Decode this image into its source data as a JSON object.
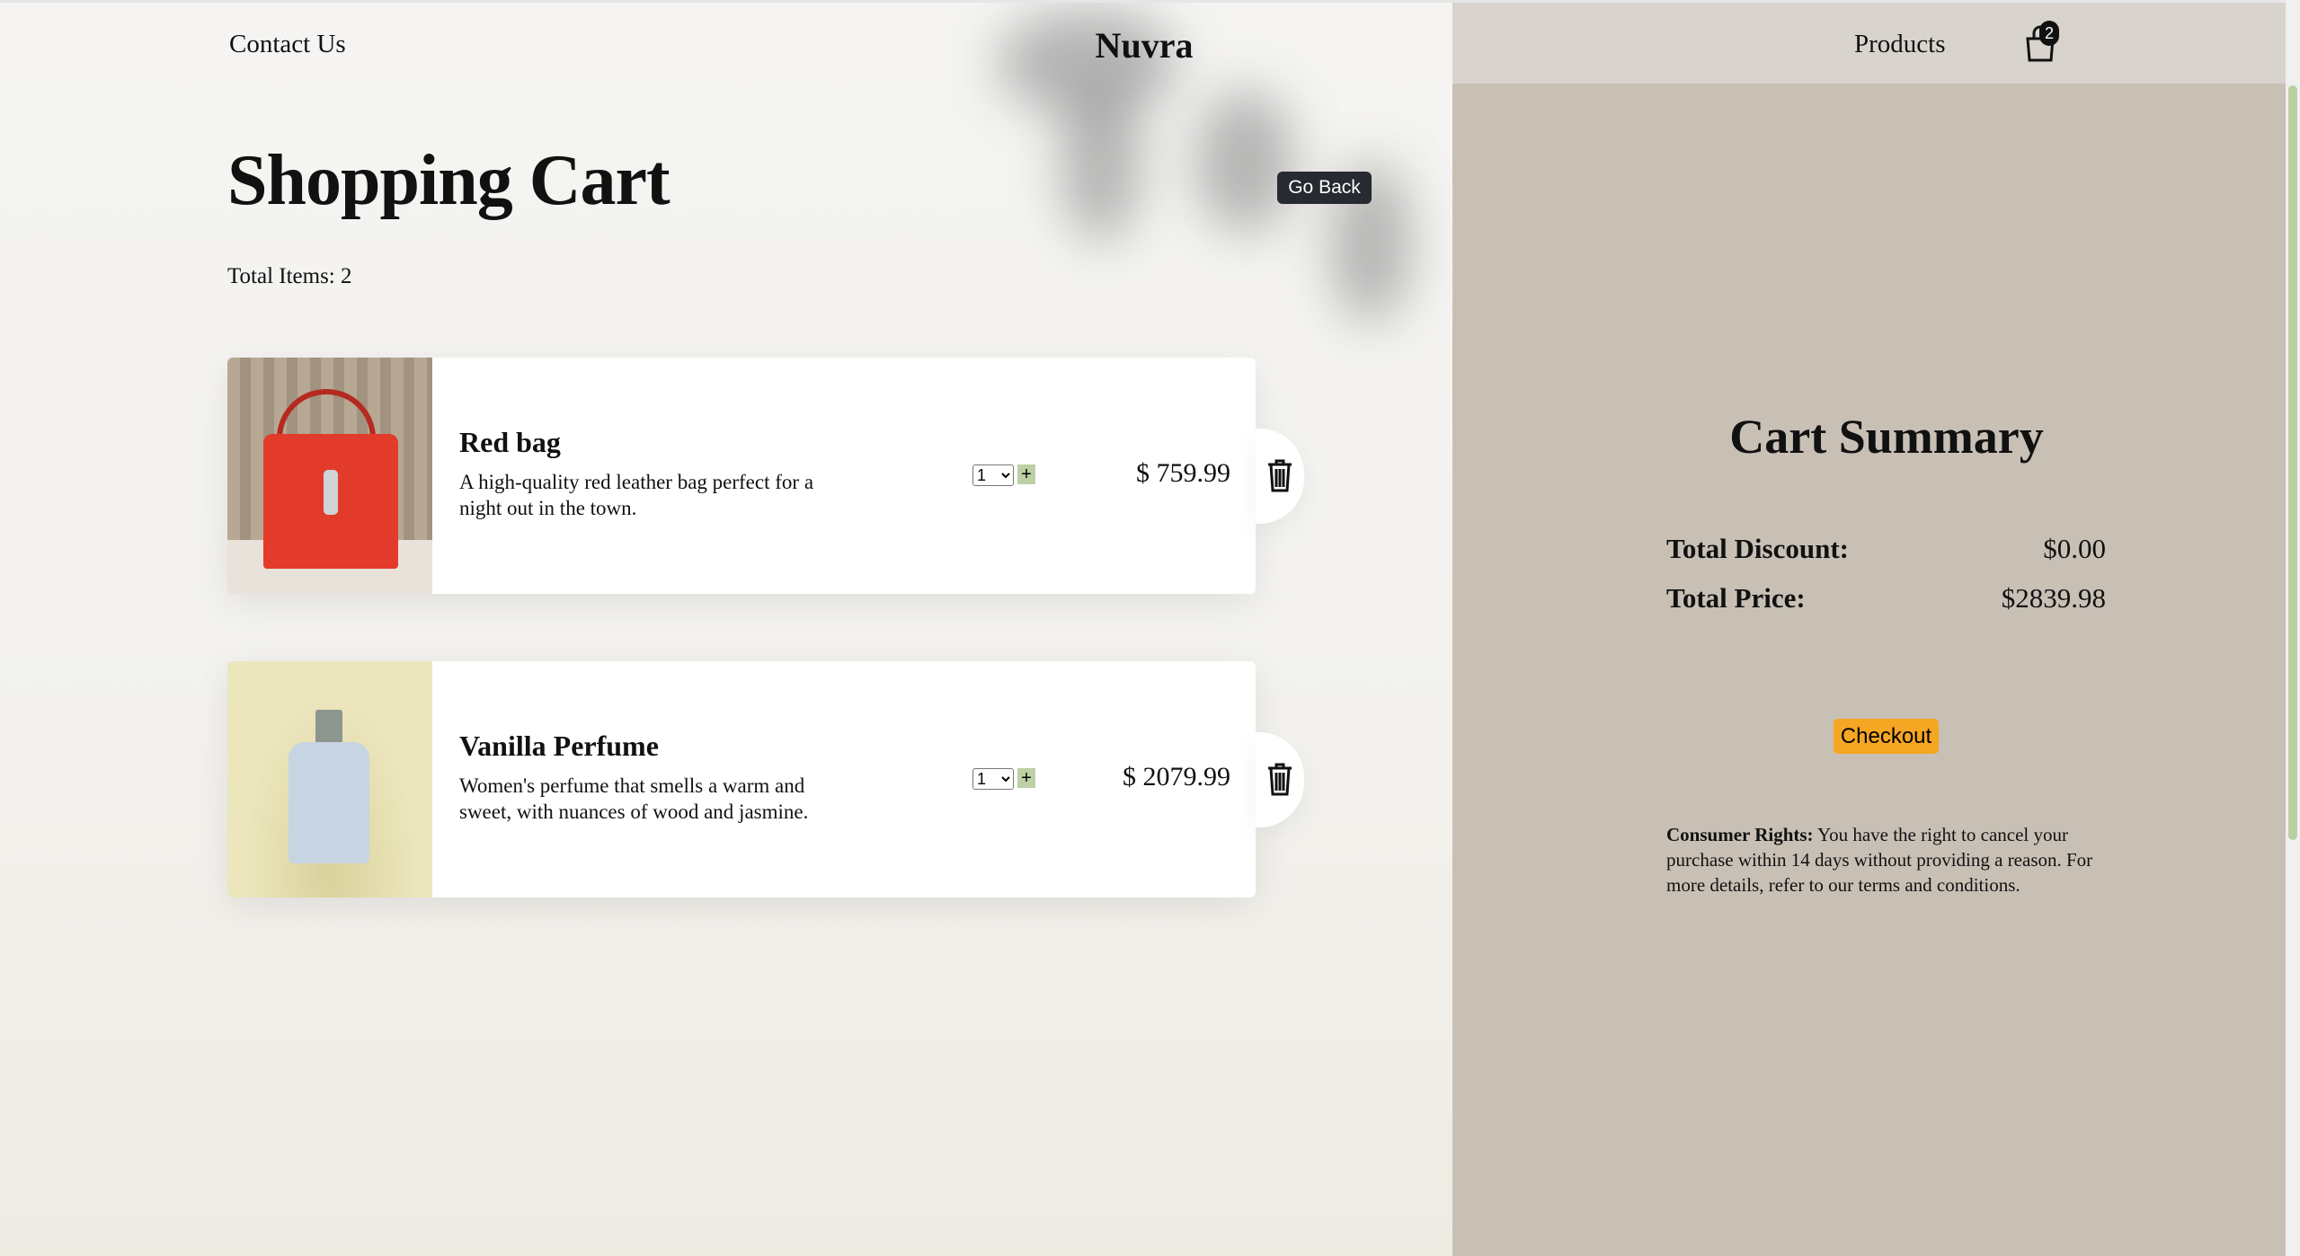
{
  "header": {
    "contact": "Contact Us",
    "logo": "Nuvra",
    "products": "Products",
    "cart_count": "2",
    "cart_icon": "shopping-bag-icon"
  },
  "main": {
    "title": "Shopping Cart",
    "go_back": "Go Back",
    "total_items": "Total Items: 2",
    "items": [
      {
        "name": "Red bag",
        "description": "A high-quality red leather bag perfect for a night out in the town.",
        "quantity": "1",
        "price": "$ 759.99"
      },
      {
        "name": "Vanilla Perfume",
        "description": "Women's perfume that smells a warm and sweet, with nuances of wood and jasmine.",
        "quantity": "1",
        "price": "$ 2079.99"
      }
    ]
  },
  "summary": {
    "title": "Cart Summary",
    "discount_label": "Total Discount:",
    "discount_value": "$0.00",
    "price_label": "Total Price:",
    "price_value": "$2839.98",
    "checkout": "Checkout",
    "rights_label": "Consumer Rights:",
    "rights_text": " You have the right to cancel your purchase within 14 days without providing a reason. For more details, refer to our terms and conditions."
  },
  "colors": {
    "panel": "#c8c0b5",
    "checkout": "#f5a623",
    "plus": "#bdd0a5",
    "go_back": "#272a30"
  }
}
